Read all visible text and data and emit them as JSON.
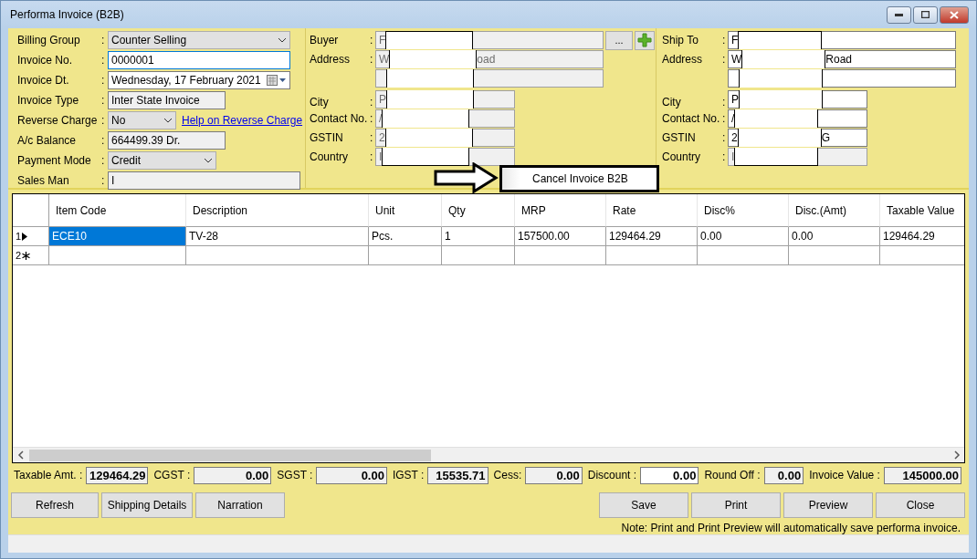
{
  "window": {
    "title": "Performa Invoice (B2B)"
  },
  "billing": [
    {
      "label": "Billing Group",
      "colon": ":",
      "kind": "combo",
      "value": "Counter Selling",
      "focused": false
    },
    {
      "label": "Invoice No.",
      "colon": ":",
      "kind": "text",
      "value": "0000001",
      "focused": true
    },
    {
      "label": "Invoice Dt.",
      "colon": ":",
      "kind": "date",
      "value": "Wednesday, 17  February  2021",
      "focused": false
    },
    {
      "label": "Invoice Type",
      "colon": ":",
      "kind": "readonly",
      "value": "Inter State Invoice",
      "focused": false
    },
    {
      "label": "Reverse Charge",
      "colon": ":",
      "kind": "combo",
      "value": "No",
      "focused": false,
      "link": "Help on Reverse Charge"
    },
    {
      "label": "A/c Balance",
      "colon": ":",
      "kind": "readonly",
      "value": "664499.39 Dr.",
      "focused": false
    },
    {
      "label": "Payment Mode",
      "colon": ":",
      "kind": "combo",
      "value": "Credit",
      "focused": false
    },
    {
      "label": "Sales Man",
      "colon": ":",
      "kind": "readonly",
      "value": "I",
      "focused": false
    }
  ],
  "buyer": {
    "fields": [
      {
        "label": "Buyer",
        "colon": ":",
        "lead": "F",
        "disabled": true
      },
      {
        "label": "Address",
        "colon": ":",
        "lead": "W",
        "tail": "oad",
        "disabled": true
      },
      {
        "disabled": true
      },
      {
        "label": "City",
        "colon": ":",
        "lead": "P",
        "disabled": true
      },
      {
        "label": "Contact No.",
        "colon": ":",
        "lead": "/",
        "disabled": true
      },
      {
        "label": "GSTIN",
        "colon": ":",
        "lead": "2",
        "disabled": true
      },
      {
        "label": "Country",
        "colon": ":",
        "lead": "I",
        "disabled": true
      }
    ],
    "browse_button": "..."
  },
  "ship_to": {
    "fields": [
      {
        "label": "Ship To",
        "colon": ":",
        "lead": "F",
        "disabled": false
      },
      {
        "label": "Address",
        "colon": ":",
        "lead": "W",
        "tail": "Road",
        "disabled": false
      },
      {
        "disabled": false
      },
      {
        "label": "City",
        "colon": ":",
        "lead": "P",
        "disabled": false
      },
      {
        "label": "Contact No.",
        "colon": ":",
        "lead": "/",
        "disabled": false
      },
      {
        "label": "GSTIN",
        "colon": ":",
        "lead": "2",
        "tail": "G",
        "disabled": false
      },
      {
        "label": "Country",
        "colon": ":",
        "lead": "I",
        "disabled": true
      }
    ]
  },
  "context_menu": {
    "items": [
      "Cancel Invoice B2B"
    ]
  },
  "table": {
    "columns": [
      "Item Code",
      "Description",
      "Unit",
      "Qty",
      "MRP",
      "Rate",
      "Disc%",
      "Disc.(Amt)",
      "Taxable Value"
    ],
    "rows": [
      {
        "number": "1",
        "kind": "current",
        "cells": [
          {
            "text": "ECE10",
            "selected": true
          },
          {
            "text": "TV-28",
            "selected": false
          },
          {
            "text": "Pcs.",
            "selected": false
          },
          {
            "text": "1",
            "selected": false
          },
          {
            "text": "157500.00",
            "selected": false
          },
          {
            "text": "129464.29",
            "selected": false
          },
          {
            "text": "0.00",
            "selected": false
          },
          {
            "text": "0.00",
            "selected": false
          },
          {
            "text": "129464.29",
            "selected": false
          }
        ]
      },
      {
        "number": "2",
        "kind": "new",
        "cells": []
      }
    ]
  },
  "totals": [
    {
      "label": "Taxable Amt. :",
      "value": "129464.29",
      "editable": false
    },
    {
      "label": "CGST :",
      "value": "0.00",
      "editable": false
    },
    {
      "label": "SGST :",
      "value": "0.00",
      "editable": false
    },
    {
      "label": "IGST :",
      "value": "15535.71",
      "editable": false
    },
    {
      "label": "Cess:",
      "value": "0.00",
      "editable": false
    },
    {
      "label": "Discount :",
      "value": "0.00",
      "editable": true
    },
    {
      "label": "Round Off :",
      "value": "0.00",
      "editable": false
    },
    {
      "label": "Invoice Value :",
      "value": "145000.00",
      "editable": false
    }
  ],
  "left_buttons": [
    "Refresh",
    "Shipping Details",
    "Narration"
  ],
  "right_buttons": [
    "Save",
    "Print",
    "Preview",
    "Close"
  ],
  "note": "Note: Print and Print Preview will automatically save performa invoice."
}
